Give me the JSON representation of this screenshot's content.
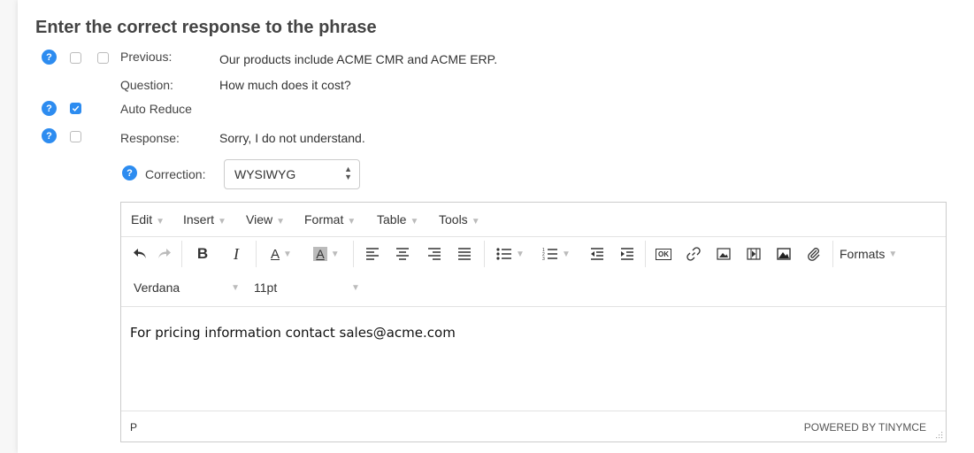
{
  "heading": "Enter the correct response to the phrase",
  "help_glyph": "?",
  "fields": {
    "previous": {
      "label": "Previous:",
      "value": "Our products include ACME CMR and ACME ERP."
    },
    "question": {
      "label": "Question:",
      "value": "How much does it cost?"
    },
    "auto_reduce": {
      "label": "Auto Reduce",
      "checked": true
    },
    "response": {
      "label": "Response:",
      "value": "Sorry, I do not understand."
    },
    "correction": {
      "label": "Correction:",
      "selected": "WYSIWYG"
    }
  },
  "editor": {
    "menus": [
      "Edit",
      "Insert",
      "View",
      "Format",
      "Table",
      "Tools"
    ],
    "toolbar": {
      "formats_label": "Formats",
      "font_family": "Verdana",
      "font_size": "11pt"
    },
    "content": "For pricing information contact sales@acme.com",
    "status_path": "P",
    "branding": "POWERED BY TINYMCE"
  },
  "colors": {
    "accent": "#2d8cf0",
    "border": "#cccccc"
  }
}
